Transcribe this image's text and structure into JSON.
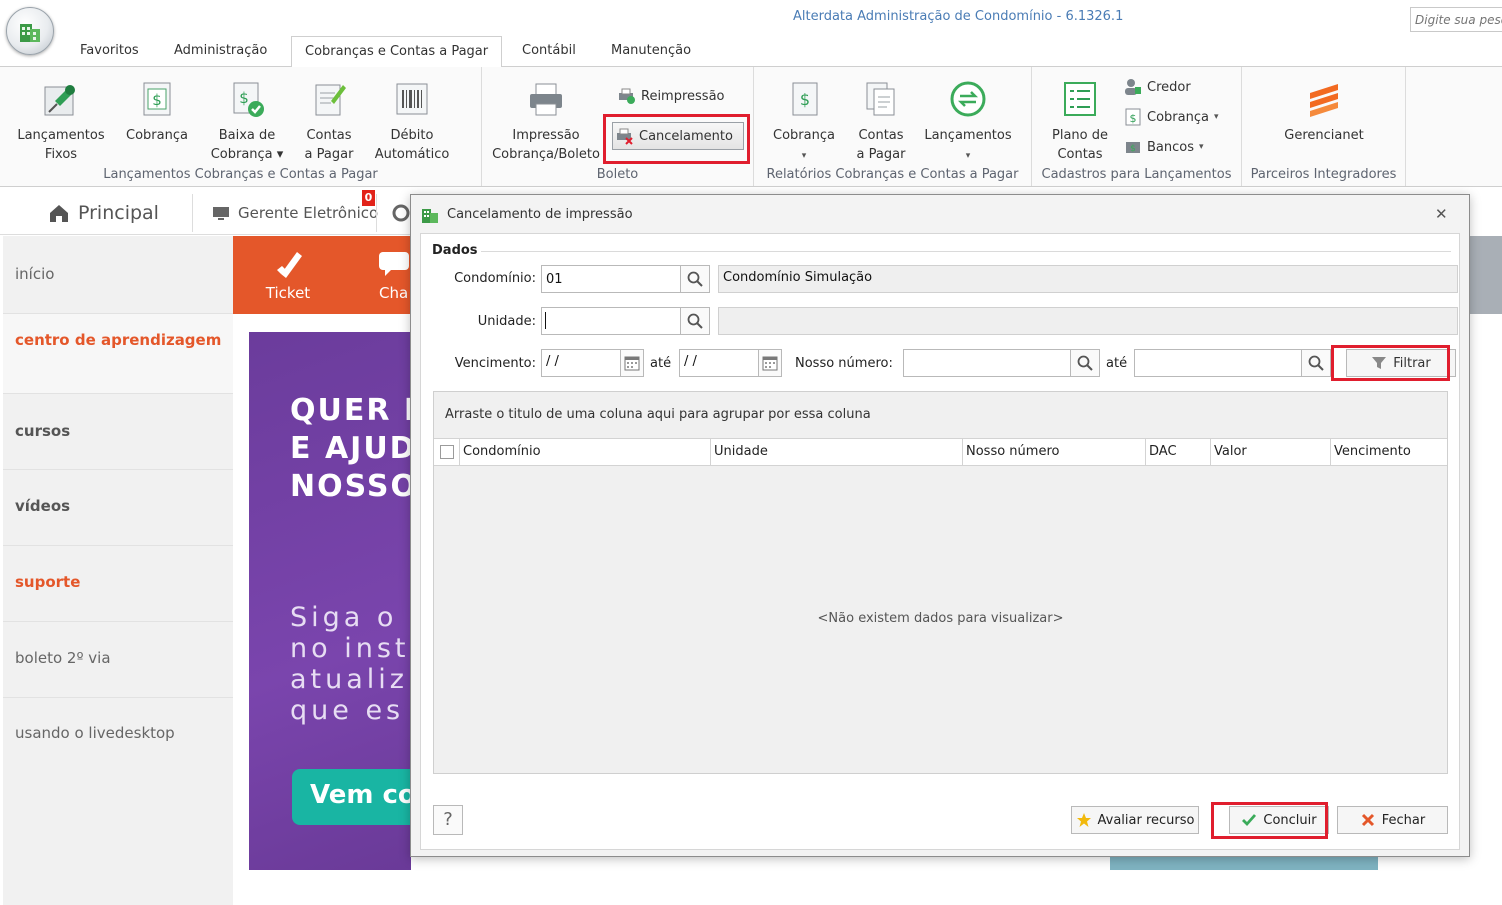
{
  "app": {
    "window_title": "Alterdata Administração de Condomínio - 6.1326.1",
    "search_placeholder": "Digite sua pesq"
  },
  "menu": {
    "tabs": [
      "Favoritos",
      "Administração",
      "Cobranças e Contas a Pagar",
      "Contábil",
      "Manutenção"
    ],
    "active_tab": "Cobranças e Contas a Pagar"
  },
  "ribbon": {
    "group1": {
      "label": "Lançamentos Cobranças e Contas a Pagar",
      "buttons": [
        {
          "line1": "Lançamentos",
          "line2": "Fixos"
        },
        {
          "line1": "Cobrança",
          "line2": ""
        },
        {
          "line1": "Baixa de",
          "line2": "Cobrança ▾"
        },
        {
          "line1": "Contas",
          "line2": "a Pagar"
        },
        {
          "line1": "Débito",
          "line2": "Automático"
        }
      ]
    },
    "group2": {
      "label": "Boleto",
      "impressao": {
        "line1": "Impressão",
        "line2": "Cobrança/Boleto"
      },
      "reimpressao": "Reimpressão",
      "cancelamento": "Cancelamento"
    },
    "group3": {
      "label": "Relatórios Cobranças e Contas a Pagar",
      "buttons": [
        {
          "line1": "Cobrança",
          "line2": "▾"
        },
        {
          "line1": "Contas",
          "line2": "a Pagar"
        },
        {
          "line1": "Lançamentos",
          "line2": "▾"
        }
      ]
    },
    "group4": {
      "label": "Cadastros para Lançamentos",
      "plano": {
        "line1": "Plano de",
        "line2": "Contas"
      },
      "credor": "Credor",
      "cobranca": "Cobrança",
      "bancos": "Bancos"
    },
    "group5": {
      "label": "Parceiros Integradores",
      "gerencianet": "Gerencianet"
    }
  },
  "main_tabs": {
    "principal": "Principal",
    "gerente": "Gerente Eletrônico",
    "badge": "0"
  },
  "sidenav": {
    "items": [
      "início",
      "centro de aprendizagem",
      "cursos",
      "vídeos",
      "suporte",
      "boleto 2º via",
      "usando o livedesktop"
    ]
  },
  "content": {
    "ticket": "Ticket",
    "chat_partial": "Cha",
    "banner_headline": [
      "QUER I",
      "E AJUD",
      "NOSSO"
    ],
    "banner_body": [
      "Siga o",
      "no inst",
      "atualiz",
      "que es"
    ],
    "banner_cta": "Vem co"
  },
  "dialog": {
    "title": "Cancelamento de impressão",
    "section": "Dados",
    "condominio_label": "Condomínio:",
    "condominio_code": "01",
    "condominio_name": "Condomínio Simulação",
    "unidade_label": "Unidade:",
    "unidade_value": "",
    "vencimento_label": "Vencimento:",
    "venc_from": " /  /",
    "ate1": "até",
    "venc_to": " /  /",
    "nosso_numero_label": "Nosso número:",
    "ate2": "até",
    "filtrar": "Filtrar",
    "group_hint": "Arraste o titulo de uma coluna aqui para agrupar por essa coluna",
    "columns": [
      "Condomínio",
      "Unidade",
      "Nosso número",
      "DAC",
      "Valor",
      "Vencimento"
    ],
    "empty_text": "<Não existem dados para visualizar>",
    "help": "?",
    "avaliar": "Avaliar recurso",
    "concluir": "Concluir",
    "fechar": "Fechar"
  },
  "colors": {
    "accent_orange": "#e4572a",
    "highlight_red": "#e01e2e",
    "banner_purple": "#7a45ad",
    "cta_teal": "#19b5a3",
    "title_blue": "#4a7cb5"
  }
}
